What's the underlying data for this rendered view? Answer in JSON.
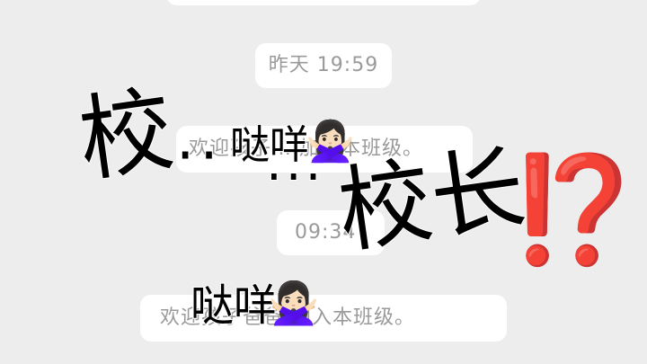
{
  "chat": {
    "time_1": "昨天 19:59",
    "message_1": "欢迎孩子… 加入本班级。",
    "time_2": "09:34",
    "message_2": "欢迎孩子爸爸 加入本班级。"
  },
  "overlay": {
    "xiao": "校",
    "dots": "··",
    "dots_2": "···",
    "dada_1": "哒咩",
    "emoji_1": "🙅🏻‍♀️",
    "xiaozhang": "校长",
    "interrobang": "⁉️",
    "dada_2": "哒咩",
    "emoji_2": "🙅🏻‍♀️"
  },
  "colors": {
    "background": "#ededed",
    "system_pill": "#ffffff",
    "system_text": "#9a9a9a",
    "overlay_text": "#000000",
    "interrobang": "#e8231c"
  }
}
